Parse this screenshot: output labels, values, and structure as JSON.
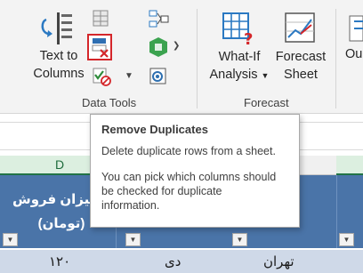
{
  "ribbon": {
    "text_to_columns": {
      "line1": "Text to",
      "line2": "Columns"
    },
    "what_if": {
      "line1": "What-If",
      "line2": "Analysis"
    },
    "forecast_sheet": {
      "line1": "Forecast",
      "line2": "Sheet"
    },
    "outline_partial": "Ou",
    "groups": {
      "data_tools": "Data Tools",
      "forecast": "Forecast"
    },
    "accent_color": "#d4262a"
  },
  "tooltip": {
    "title": "Remove Duplicates",
    "line1": "Delete duplicate rows from a sheet.",
    "line2": "You can pick which columns should",
    "line3": "be checked for duplicate",
    "line4": "information."
  },
  "sheet": {
    "column_letter": "D",
    "header_text_line1": "میزان فروش",
    "header_text_line2": "(تومان)",
    "header_color": "#4a74a8",
    "row": {
      "sales": "۱۲۰",
      "month": "دی",
      "city": "تهران"
    }
  }
}
